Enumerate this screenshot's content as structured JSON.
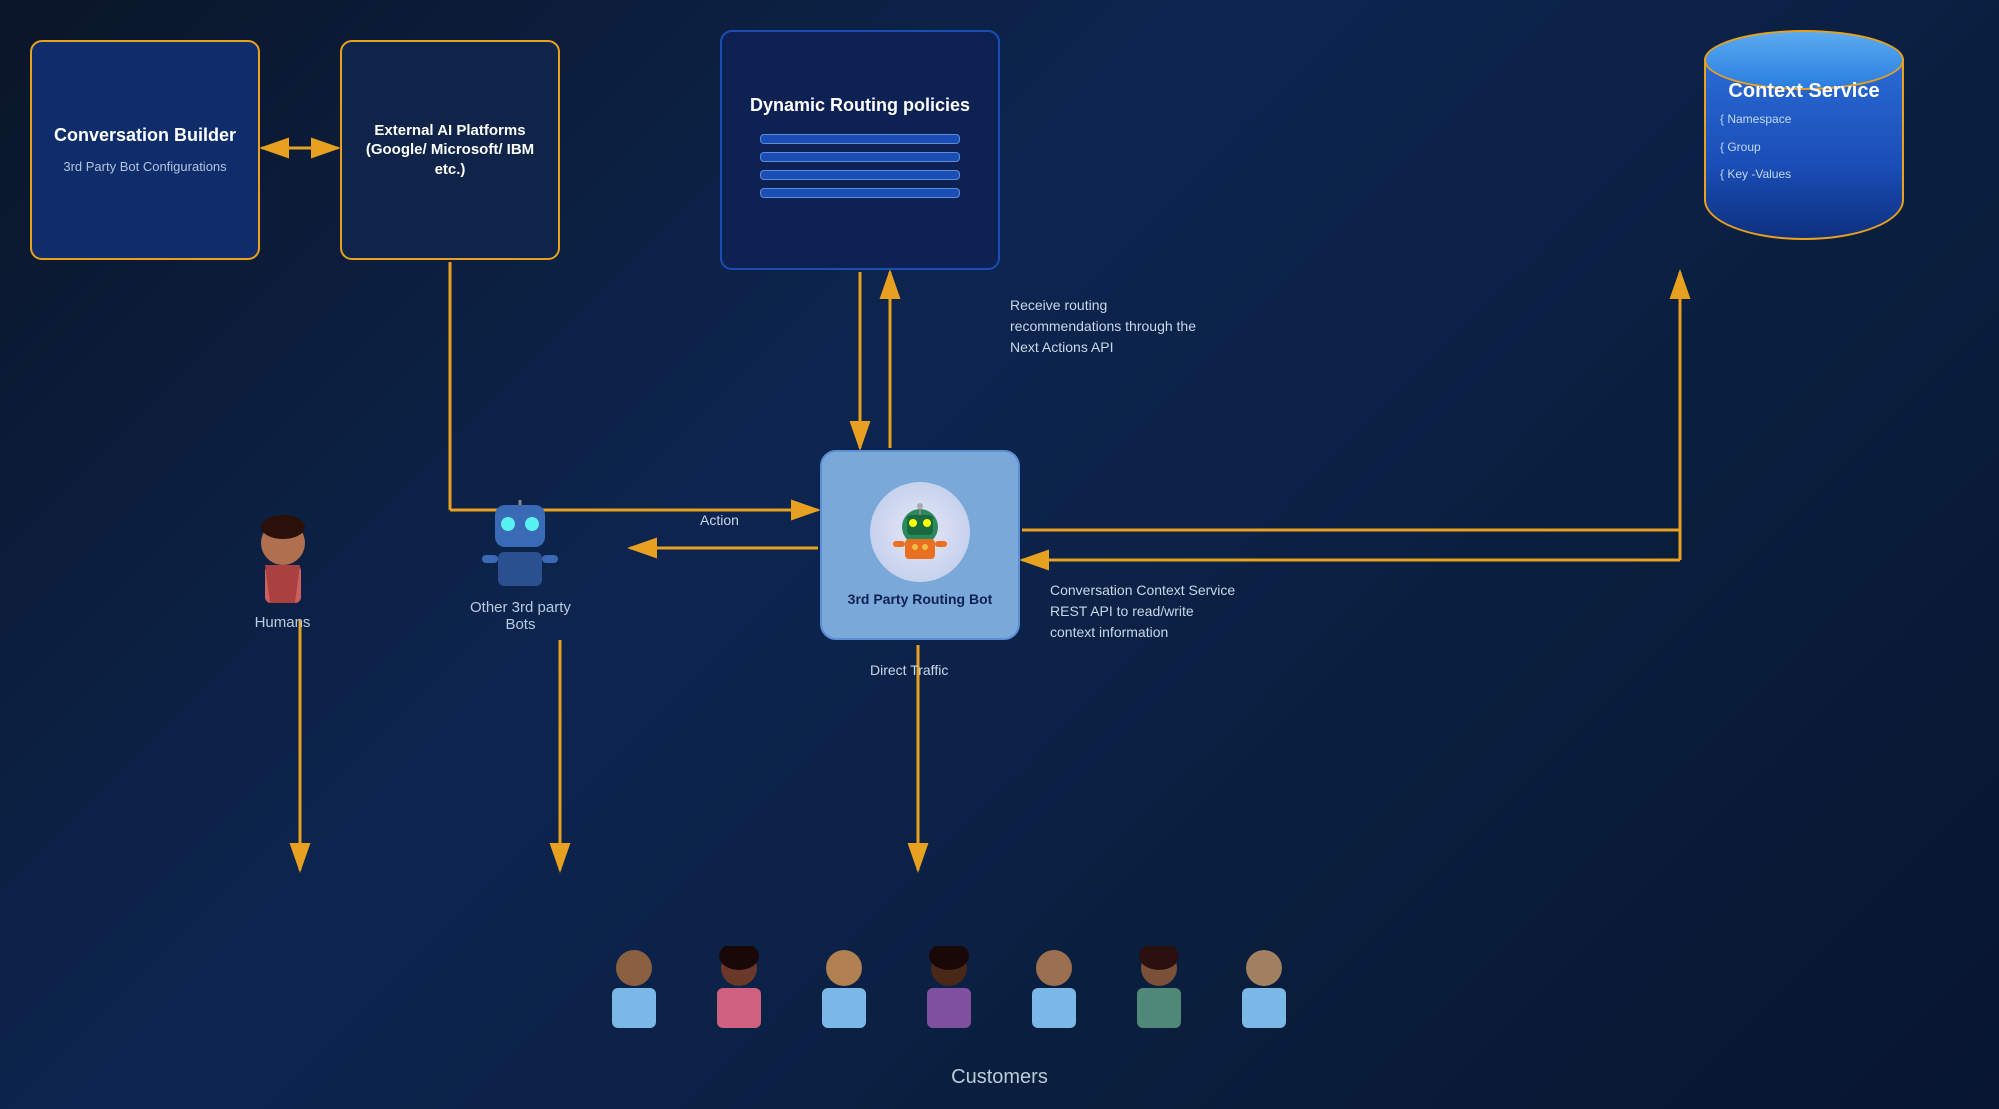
{
  "boxes": {
    "conversation_builder": {
      "title": "Conversation Builder",
      "subtitle": "3rd Party Bot Configurations"
    },
    "external_ai": {
      "title": "External AI Platforms (Google/ Microsoft/ IBM etc.)"
    },
    "dynamic_routing": {
      "title": "Dynamic Routing policies"
    },
    "context_service": {
      "title": "Context Service",
      "detail_namespace": "{ Namespace",
      "detail_group": "{ Group",
      "detail_keyvalues": "{ Key -Values"
    },
    "routing_bot": {
      "title": "3rd Party Routing Bot"
    }
  },
  "labels": {
    "receive_routing": "Receive routing\nrecommendations through the\nNext Actions API",
    "action": "Action",
    "direct_traffic": "Direct Traffic",
    "context_service_rest": "Conversation Context Service\nREST API to read/write\ncontext information",
    "humans": "Humans",
    "other_bots": "Other 3rd party\nBots",
    "customers": "Customers"
  }
}
